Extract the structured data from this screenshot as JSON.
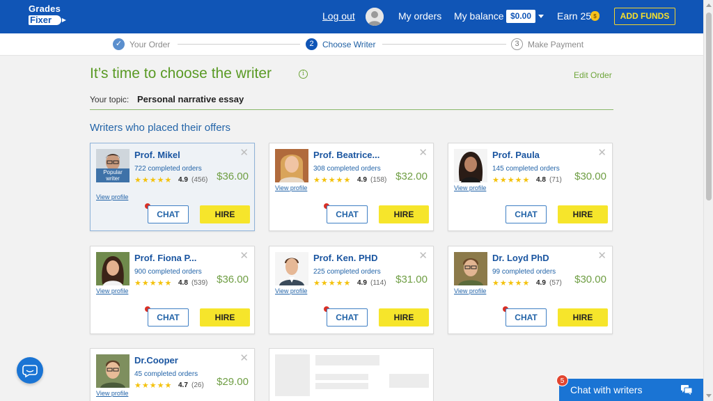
{
  "header": {
    "logo_top": "Grades",
    "logo_bottom": "Fixer",
    "logout": "Log out",
    "my_orders": "My orders",
    "my_balance": "My balance",
    "balance_value": "$0.00",
    "earn": "Earn 25",
    "add_funds": "ADD FUNDS"
  },
  "steps": [
    {
      "num": "✓",
      "label": "Your Order"
    },
    {
      "num": "2",
      "label": "Choose Writer"
    },
    {
      "num": "3",
      "label": "Make Payment"
    }
  ],
  "page": {
    "title": "It’s time to choose the writer",
    "edit_order": "Edit Order",
    "topic_label": "Your topic:",
    "topic_value": "Personal narrative essay",
    "section_title": "Writers who placed their offers"
  },
  "writers": [
    {
      "name": "Prof. Mikel",
      "completed": "722 completed orders",
      "rating": "4.9",
      "reviews": "(456)",
      "price": "$36.00",
      "popular": true,
      "badge": "Popular writer",
      "view": "View profile",
      "chat": "CHAT",
      "hire": "HIRE"
    },
    {
      "name": "Prof. Beatrice...",
      "completed": "308 completed orders",
      "rating": "4.9",
      "reviews": "(158)",
      "price": "$32.00",
      "view": "View profile",
      "chat": "CHAT",
      "hire": "HIRE"
    },
    {
      "name": "Prof. Paula",
      "completed": "145 completed orders",
      "rating": "4.8",
      "reviews": "(71)",
      "price": "$30.00",
      "view": "View profile",
      "chat": "CHAT",
      "hire": "HIRE"
    },
    {
      "name": "Prof. Fiona P...",
      "completed": "900 completed orders",
      "rating": "4.8",
      "reviews": "(539)",
      "price": "$36.00",
      "view": "View profile",
      "chat": "CHAT",
      "hire": "HIRE"
    },
    {
      "name": "Prof. Ken. PHD",
      "completed": "225 completed orders",
      "rating": "4.9",
      "reviews": "(114)",
      "price": "$31.00",
      "view": "View profile",
      "chat": "CHAT",
      "hire": "HIRE"
    },
    {
      "name": "Dr. Loyd PhD",
      "completed": "99 completed orders",
      "rating": "4.9",
      "reviews": "(57)",
      "price": "$30.00",
      "view": "View profile",
      "chat": "CHAT",
      "hire": "HIRE"
    },
    {
      "name": "Dr.Cooper",
      "completed": "45 completed orders",
      "rating": "4.7",
      "reviews": "(26)",
      "price": "$29.00",
      "view": "View profile"
    }
  ],
  "chat_bar": {
    "label": "Chat with writers",
    "count": "5"
  },
  "colors": {
    "brand_blue": "#1055b6",
    "accent_green": "#5a9a25",
    "hire_yellow": "#f6e52b"
  }
}
